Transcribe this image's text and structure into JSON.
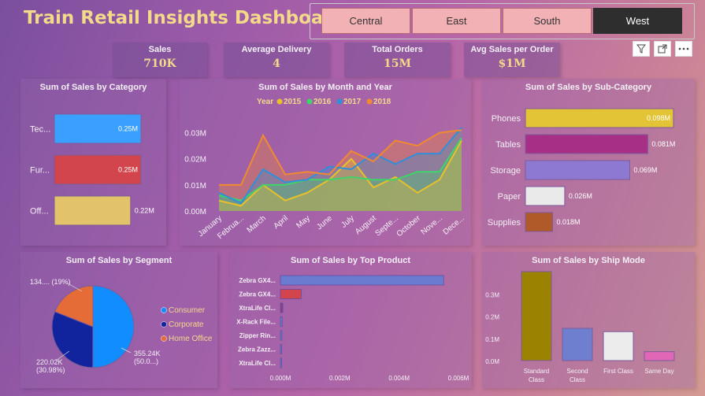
{
  "title": "Train Retail Insights Dashboard",
  "slicer": {
    "options": [
      "Central",
      "East",
      "South",
      "West"
    ],
    "selected": "West"
  },
  "kpis": [
    {
      "label": "Sales",
      "value": "710K"
    },
    {
      "label": "Average Delivery",
      "value": "4"
    },
    {
      "label": "Total Orders",
      "value": "15M"
    },
    {
      "label": "Avg Sales per Order",
      "value": "$1M"
    }
  ],
  "header_icons": [
    "filter-icon",
    "expand-icon",
    "more-options-icon"
  ],
  "chart_data": [
    {
      "id": "category",
      "type": "bar",
      "orientation": "horizontal",
      "title": "Sum of Sales by Category",
      "categories": [
        "Tec...",
        "Fur...",
        "Off..."
      ],
      "values": [
        0.25,
        0.25,
        0.22
      ],
      "data_labels": [
        "0.25M",
        "0.25M",
        "0.22M"
      ],
      "colors": [
        "#3aa0ff",
        "#d2454d",
        "#e2c36a"
      ]
    },
    {
      "id": "month_year",
      "type": "area",
      "title": "Sum of Sales by Month and Year",
      "legend_title": "Year",
      "categories": [
        "January",
        "Februa...",
        "March",
        "April",
        "May",
        "June",
        "July",
        "August",
        "Septe...",
        "October",
        "Nove...",
        "Dece..."
      ],
      "yticks": [
        "0.00M",
        "0.01M",
        "0.02M",
        "0.03M"
      ],
      "ylim": [
        0,
        0.035
      ],
      "series": [
        {
          "name": "2015",
          "color": "#e8c02a",
          "values": [
            0.004,
            0.002,
            0.01,
            0.004,
            0.007,
            0.012,
            0.02,
            0.009,
            0.013,
            0.007,
            0.012,
            0.027
          ]
        },
        {
          "name": "2016",
          "color": "#3fd36a",
          "values": [
            0.006,
            0.004,
            0.01,
            0.01,
            0.012,
            0.012,
            0.013,
            0.012,
            0.012,
            0.015,
            0.015,
            0.028
          ]
        },
        {
          "name": "2017",
          "color": "#2f8fd8",
          "values": [
            0.007,
            0.003,
            0.016,
            0.011,
            0.012,
            0.017,
            0.016,
            0.022,
            0.018,
            0.022,
            0.022,
            0.032
          ]
        },
        {
          "name": "2018",
          "color": "#f08a30",
          "values": [
            0.01,
            0.01,
            0.029,
            0.014,
            0.015,
            0.014,
            0.023,
            0.019,
            0.027,
            0.025,
            0.03,
            0.031
          ]
        }
      ]
    },
    {
      "id": "subcategory",
      "type": "bar",
      "orientation": "horizontal",
      "title": "Sum of Sales by Sub-Category",
      "categories": [
        "Phones",
        "Tables",
        "Storage",
        "Paper",
        "Supplies"
      ],
      "values": [
        0.098,
        0.081,
        0.069,
        0.026,
        0.018
      ],
      "data_labels": [
        "0.098M",
        "0.081M",
        "0.069M",
        "0.026M",
        "0.018M"
      ],
      "colors": [
        "#e2c436",
        "#a82f86",
        "#8e79d2",
        "#eaeaea",
        "#b05a2a"
      ]
    },
    {
      "id": "segment",
      "type": "pie",
      "title": "Sum of Sales by Segment",
      "labels": [
        "Consumer",
        "Corporate",
        "Home Office"
      ],
      "values": [
        355.24,
        220.02,
        134.74
      ],
      "slice_labels": [
        "355.24K\n(50.0...)",
        "220.02K\n(30.98%)",
        "134.... (19%)"
      ],
      "colors": [
        "#118dff",
        "#12239e",
        "#e66c37"
      ]
    },
    {
      "id": "top_product",
      "type": "bar",
      "orientation": "horizontal",
      "title": "Sum of Sales by Top Product",
      "categories": [
        "Zebra GX4...",
        "Zebra GX4...",
        "XtraLife Cl...",
        "X-Rack File...",
        "Zipper Rin...",
        "Zebra Zazz...",
        "XtraLife Cl..."
      ],
      "values": [
        0.0055,
        0.0007,
        8e-05,
        6e-05,
        5e-05,
        4e-05,
        3e-05
      ],
      "xticks": [
        "0.000M",
        "0.002M",
        "0.004M",
        "0.006M"
      ],
      "xlim": [
        0,
        0.006
      ],
      "colors": [
        "#6b7bcf",
        "#d2454d",
        "#8e3c8a",
        "#6b7bcf",
        "#6b7bcf",
        "#6b7bcf",
        "#6b7bcf"
      ]
    },
    {
      "id": "ship_mode",
      "type": "bar",
      "orientation": "vertical",
      "title": "Sum of Sales by Ship Mode",
      "categories": [
        "Standard Class",
        "Second Class",
        "First Class",
        "Same Day"
      ],
      "values": [
        0.4,
        0.145,
        0.13,
        0.04
      ],
      "yticks": [
        "0.0M",
        "0.1M",
        "0.2M",
        "0.3M"
      ],
      "ylim": [
        0,
        0.4
      ],
      "colors": [
        "#9b8200",
        "#6f7fd0",
        "#ececec",
        "#e066b6"
      ]
    }
  ]
}
